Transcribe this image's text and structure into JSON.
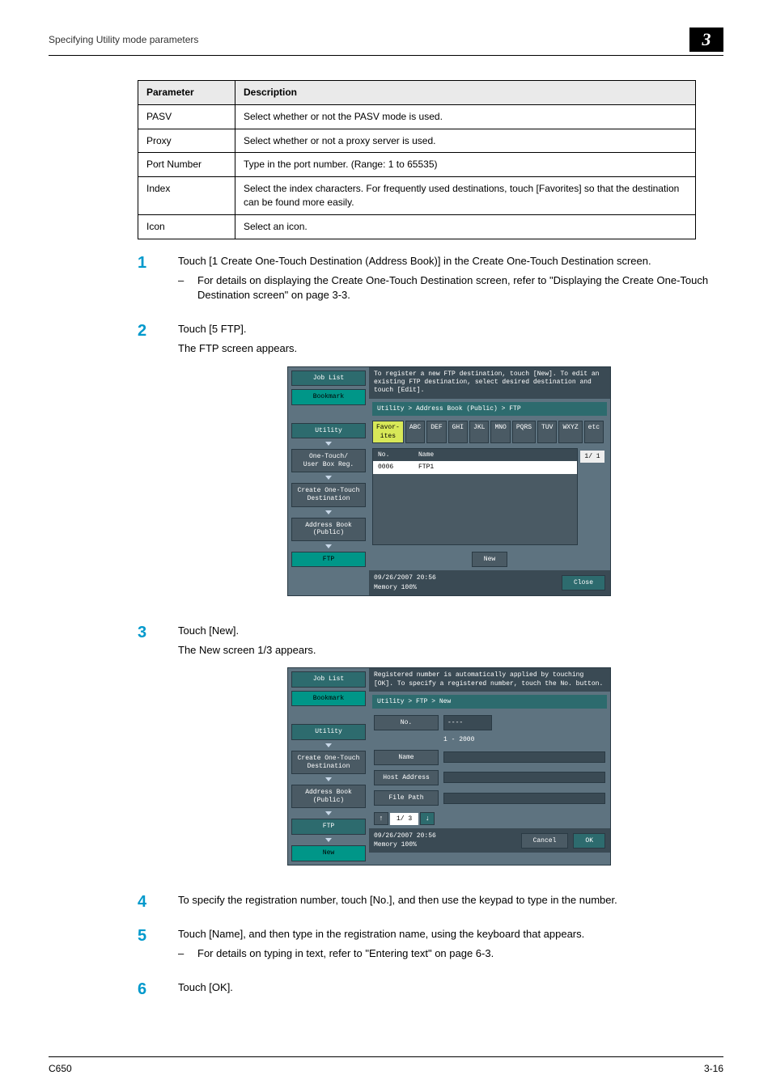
{
  "header": {
    "section_title": "Specifying Utility mode parameters",
    "chapter_number": "3"
  },
  "param_table": {
    "columns": [
      "Parameter",
      "Description"
    ],
    "rows": [
      {
        "param": "PASV",
        "desc": "Select whether or not the PASV mode is used."
      },
      {
        "param": "Proxy",
        "desc": "Select whether or not a proxy server is used."
      },
      {
        "param": "Port Number",
        "desc": "Type in the port number. (Range: 1 to 65535)"
      },
      {
        "param": "Index",
        "desc": "Select the index characters. For frequently used destinations, touch [Favorites] so that the destination can be found more easily."
      },
      {
        "param": "Icon",
        "desc": "Select an icon."
      }
    ]
  },
  "steps": {
    "s1": {
      "num": "1",
      "text": "Touch [1 Create One-Touch Destination (Address Book)] in the Create One-Touch Destination screen.",
      "note": "For details on displaying the Create One-Touch Destination screen, refer to \"Displaying the Create One-Touch Destination screen\" on page 3-3."
    },
    "s2": {
      "num": "2",
      "text": "Touch [5 FTP].",
      "after": "The FTP screen appears."
    },
    "s3": {
      "num": "3",
      "text": "Touch [New].",
      "after": "The New screen 1/3 appears."
    },
    "s4": {
      "num": "4",
      "text": "To specify the registration number, touch [No.], and then use the keypad to type in the number."
    },
    "s5": {
      "num": "5",
      "text": "Touch [Name], and then type in the registration name, using the keyboard that appears.",
      "note": "For details on typing in text, refer to \"Entering text\" on page 6-3."
    },
    "s6": {
      "num": "6",
      "text": "Touch [OK]."
    }
  },
  "shot1": {
    "hint": "To register a new FTP destination, touch [New]. To edit an existing FTP destination, select desired destination and touch [Edit].",
    "crumb": "Utility > Address Book (Public) > FTP",
    "side": {
      "job_list": "Job List",
      "bookmark": "Bookmark",
      "utility": "Utility",
      "one_touch": "One-Touch/\nUser Box Reg.",
      "create": "Create One-Touch\nDestination",
      "address_book": "Address Book\n(Public)",
      "ftp": "FTP"
    },
    "tabs": [
      "Favor-\nites",
      "ABC",
      "DEF",
      "GHI",
      "JKL",
      "MNO",
      "PQRS",
      "TUV",
      "WXYZ",
      "etc"
    ],
    "list_head": {
      "no": "No.",
      "name": "Name"
    },
    "list_row": {
      "no": "0006",
      "name": "FTP1"
    },
    "page_ind": "1/  1",
    "new_btn": "New",
    "datetime": "09/26/2007   20:56",
    "memory": "Memory        100%",
    "close": "Close"
  },
  "shot2": {
    "hint": "Registered number is automatically applied by touching [OK]. To specify a registered number, touch the No. button.",
    "crumb": "Utility > FTP > New",
    "side": {
      "job_list": "Job List",
      "bookmark": "Bookmark",
      "utility": "Utility",
      "create": "Create One-Touch\nDestination",
      "address_book": "Address Book\n(Public)",
      "ftp": "FTP",
      "new": "New"
    },
    "form": {
      "no_label": "No.",
      "no_val": "----",
      "range": "1 - 2000",
      "name_label": "Name",
      "host_label": "Host Address",
      "path_label": "File Path"
    },
    "pager": "1/ 3",
    "datetime": "09/26/2007   20:56",
    "memory": "Memory        100%",
    "cancel": "Cancel",
    "ok": "OK"
  },
  "footer": {
    "left": "C650",
    "right": "3-16"
  }
}
